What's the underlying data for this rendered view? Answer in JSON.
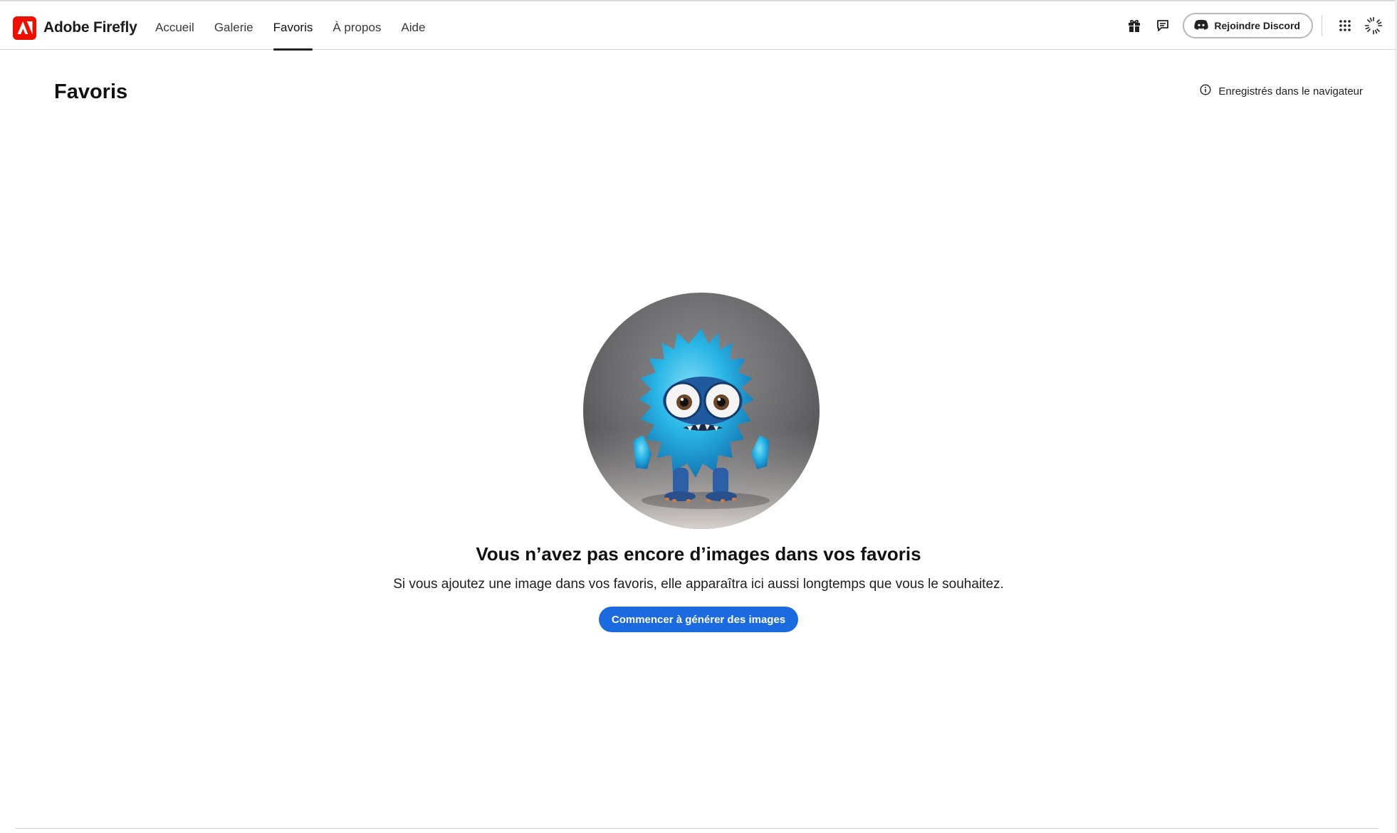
{
  "header": {
    "brand_name": "Adobe Firefly",
    "nav": [
      {
        "label": "Accueil",
        "active": false
      },
      {
        "label": "Galerie",
        "active": false
      },
      {
        "label": "Favoris",
        "active": true
      },
      {
        "label": "À propos",
        "active": false
      },
      {
        "label": "Aide",
        "active": false
      }
    ],
    "icons": [
      "gift-icon",
      "feedback-icon",
      "apps-grid-icon",
      "loading-spinner-icon"
    ],
    "discord_label": "Rejoindre Discord"
  },
  "page": {
    "title": "Favoris",
    "storage_note": "Enregistrés dans le navigateur"
  },
  "empty_state": {
    "title": "Vous n’avez pas encore d’images dans vos favoris",
    "description": "Si vous ajoutez une image dans vos favoris, elle apparaîtra ici aussi longtemps que vous le souhaitez.",
    "cta_label": "Commencer à générer des images"
  },
  "colors": {
    "adobe_red": "#eb1000",
    "cta_blue": "#1b6ae0",
    "monster_blue": "#29b6e6"
  }
}
